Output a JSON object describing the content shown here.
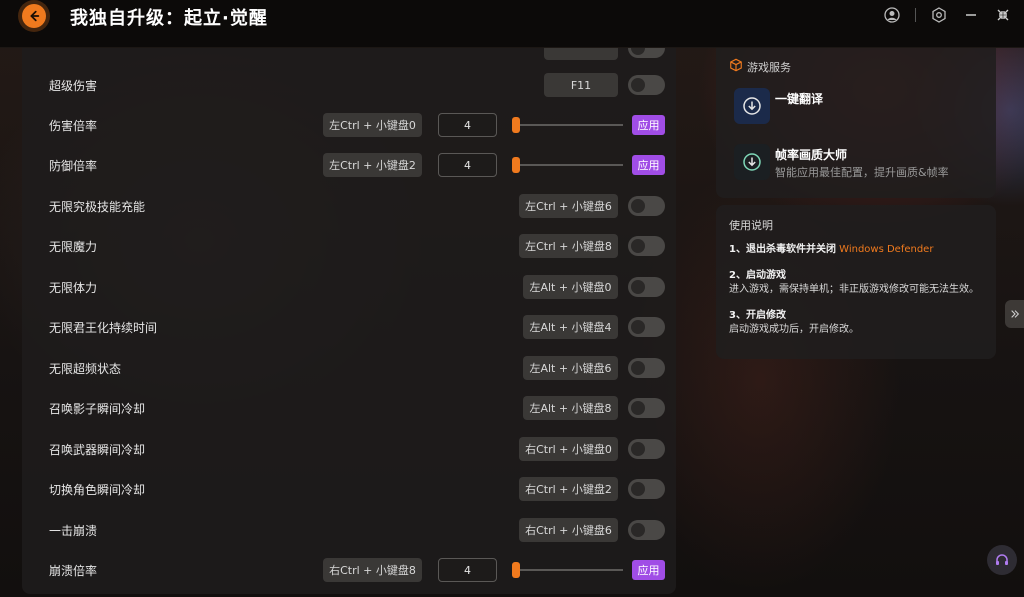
{
  "app": {
    "title": "我独自升级：起立·觉醒"
  },
  "colors": {
    "accent": "#f07a1e",
    "apply": "#a04de6",
    "toggle_off": "#4a4846"
  },
  "toggles": [
    {
      "label": "",
      "hotkey": "",
      "on": false
    },
    {
      "label": "超级伤害",
      "hotkey": "F11",
      "on": false
    },
    {
      "label": "无限究极技能充能",
      "hotkey": "左Ctrl + 小键盘6",
      "on": false
    },
    {
      "label": "无限魔力",
      "hotkey": "左Ctrl + 小键盘8",
      "on": false
    },
    {
      "label": "无限体力",
      "hotkey": "左Alt + 小键盘0",
      "on": false
    },
    {
      "label": "无限君王化持续时间",
      "hotkey": "左Alt + 小键盘4",
      "on": false
    },
    {
      "label": "无限超频状态",
      "hotkey": "左Alt + 小键盘6",
      "on": false
    },
    {
      "label": "召唤影子瞬间冷却",
      "hotkey": "左Alt + 小键盘8",
      "on": false
    },
    {
      "label": "召唤武器瞬间冷却",
      "hotkey": "右Ctrl + 小键盘0",
      "on": false
    },
    {
      "label": "切换角色瞬间冷却",
      "hotkey": "右Ctrl + 小键盘2",
      "on": false
    },
    {
      "label": "一击崩溃",
      "hotkey": "右Ctrl + 小键盘6",
      "on": false
    }
  ],
  "sliders": [
    {
      "label": "伤害倍率",
      "hotkey": "左Ctrl + 小键盘0",
      "value": "4",
      "position": 0.0,
      "apply_label": "应用"
    },
    {
      "label": "防御倍率",
      "hotkey": "左Ctrl + 小键盘2",
      "value": "4",
      "position": 0.0,
      "apply_label": "应用"
    },
    {
      "label": "崩溃倍率",
      "hotkey": "右Ctrl + 小键盘8",
      "value": "4",
      "position": 0.0,
      "apply_label": "应用"
    }
  ],
  "services": {
    "header": "游戏服务",
    "items": [
      {
        "title": "一键翻译",
        "subtitle": ""
      },
      {
        "title": "帧率画质大师",
        "subtitle": "智能应用最佳配置，提升画质&帧率"
      }
    ]
  },
  "usage": {
    "title": "使用说明",
    "step1_title": "1、退出杀毒软件并关闭",
    "step1_highlight": "Windows Defender",
    "step2_title": "2、启动游戏",
    "step2_text": "进入游戏，需保持单机；非正版游戏修改可能无法生效。",
    "step3_title": "3、开启修改",
    "step3_text": "启动游戏成功后，开启修改。"
  }
}
